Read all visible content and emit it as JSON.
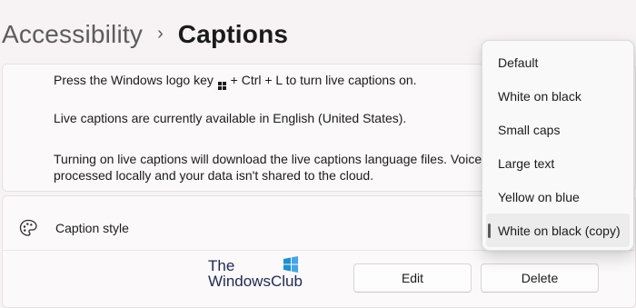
{
  "breadcrumb": {
    "parent": "Accessibility",
    "separator": "›",
    "current": "Captions"
  },
  "info": {
    "shortcut_pre": "Press the Windows logo key",
    "shortcut_icon": "windows-logo-icon",
    "shortcut_post": "+ Ctrl + L to turn live captions on.",
    "availability": "Live captions are currently available in English (United States).",
    "download_line1": "Turning on live captions will download the live captions language files. Voice",
    "download_line2": "processed locally and your data isn't shared to the cloud."
  },
  "caption_style": {
    "icon": "palette-icon",
    "label": "Caption style",
    "edit_label": "Edit",
    "delete_label": "Delete"
  },
  "watermark": {
    "line1": "The",
    "line2": "WindowsClub"
  },
  "dropdown": {
    "items": [
      {
        "label": "Default"
      },
      {
        "label": "White on black"
      },
      {
        "label": "Small caps"
      },
      {
        "label": "Large text"
      },
      {
        "label": "Yellow on blue"
      },
      {
        "label": "White on black (copy)"
      }
    ],
    "selected": "White on black (copy)"
  },
  "colors": {
    "background": "#f7f2f3",
    "card": "#fbf9f9",
    "selection_indicator": "#5a5a5a",
    "logo_blue": "#1c8fd9"
  }
}
